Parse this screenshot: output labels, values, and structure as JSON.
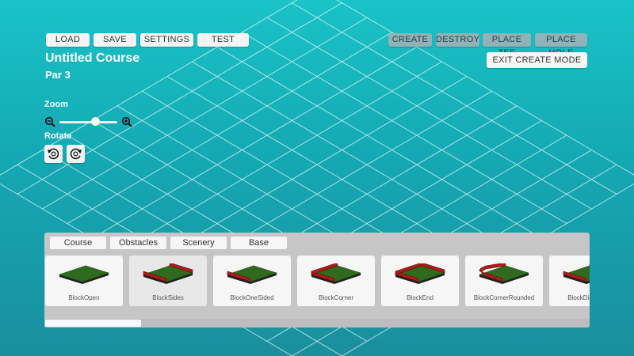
{
  "toolbar": {
    "load": "LOAD",
    "save": "SAVE",
    "settings": "SETTINGS",
    "test": "TEST"
  },
  "modes": {
    "create": "CREATE",
    "destroy": "DESTROY",
    "place_tee": "PLACE TEE",
    "place_hole": "PLACE HOLE",
    "exit": "EXIT CREATE MODE"
  },
  "course": {
    "title": "Untitled Course",
    "par": "Par 3"
  },
  "controls": {
    "zoom_label": "Zoom",
    "zoom_level": 0.62,
    "rotate_label": "Rotate"
  },
  "palette": {
    "tabs": [
      "Course",
      "Obstacles",
      "Scenery",
      "Base"
    ],
    "active_tab": "Course",
    "selected": "BlockSides",
    "scroll_position": 0.0,
    "items": [
      {
        "name": "BlockOpen",
        "walls": "none"
      },
      {
        "name": "BlockSides",
        "walls": "sides"
      },
      {
        "name": "BlockOneSided",
        "walls": "one"
      },
      {
        "name": "BlockCorner",
        "walls": "corner"
      },
      {
        "name": "BlockEnd",
        "walls": "end"
      },
      {
        "name": "BlockCornerRounded",
        "walls": "corner-rounded"
      },
      {
        "name": "BlockDiamond",
        "walls": "sides"
      }
    ]
  },
  "colors": {
    "turf": "#2f6b1f",
    "wall": "#b01a1a",
    "grid_line": "#d9f2f3"
  }
}
